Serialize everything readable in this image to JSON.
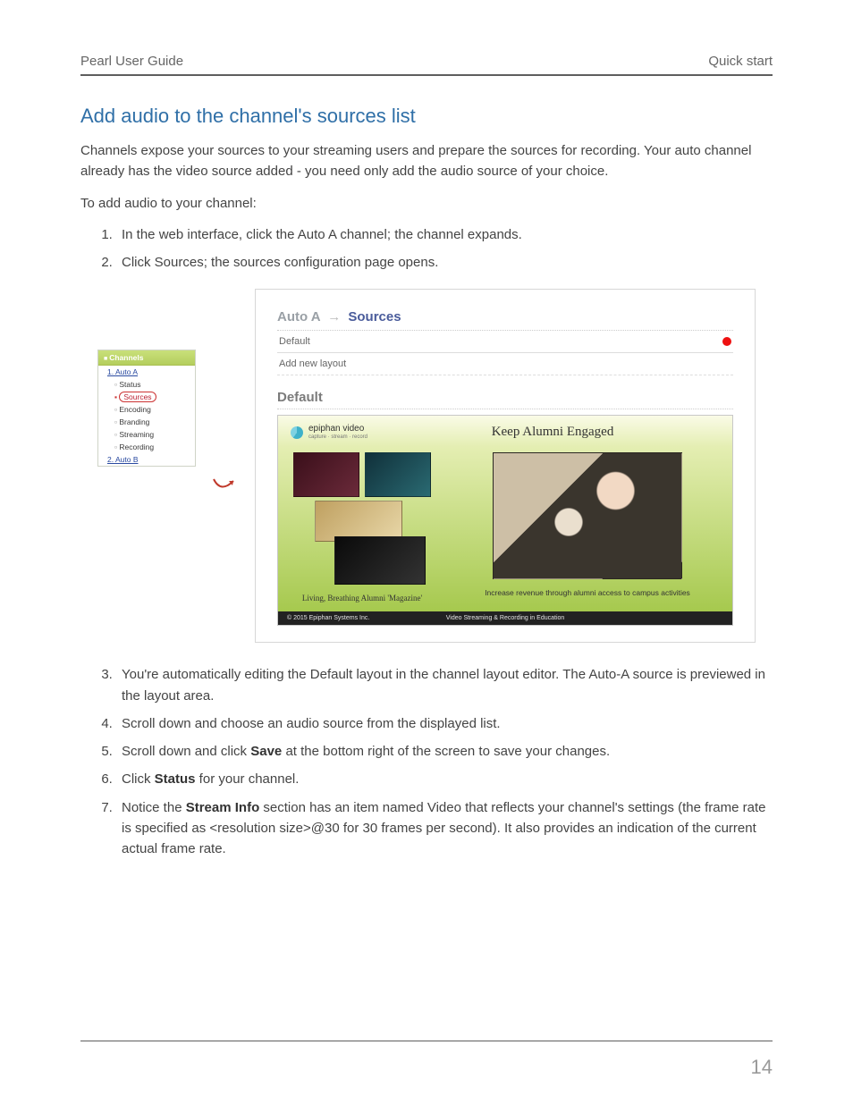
{
  "header": {
    "left": "Pearl User Guide",
    "right": "Quick start"
  },
  "title": "Add audio to the channel's sources list",
  "intro": "Channels expose your sources to your streaming users and prepare the sources for recording. Your auto channel already has the video source added - you need only add the audio source of your choice.",
  "lead": "To add audio to your channel:",
  "steps_a": [
    "In the web interface, click the Auto A channel; the channel expands.",
    "Click Sources; the sources configuration page opens."
  ],
  "steps_b": {
    "s3": "You're automatically editing the Default layout in the channel layout editor. The Auto-A source is previewed in the layout area.",
    "s4": "Scroll down and choose an audio source from the displayed list.",
    "s5a": "Scroll down and click ",
    "s5b": "Save",
    "s5c": " at the bottom right of the screen to save your changes.",
    "s6a": "Click ",
    "s6b": "Status",
    "s6c": "  for your channel.",
    "s7a": "Notice the ",
    "s7b": "Stream Info",
    "s7c": " section has an item named Video that reflects your channel's settings (the frame rate is specified as <resolution size>@30 for 30 frames per second). It also provides an indication of the current actual frame rate."
  },
  "sidebar": {
    "header": "Channels",
    "item1_prefix": "1. ",
    "item1": "Auto A",
    "subs": [
      "Status",
      "Sources",
      "Encoding",
      "Branding",
      "Streaming",
      "Recording"
    ],
    "item2_prefix": "2. ",
    "item2": "Auto B"
  },
  "panel": {
    "crumb_a": "Auto A",
    "crumb_b": "Sources",
    "row_default": "Default",
    "row_add": "Add new layout",
    "section": "Default",
    "brand": "epiphan video",
    "brand_tag": "capture · stream · record",
    "slide_title": "Keep Alumni Engaged",
    "collage_cap": "Living, Breathing Alumni 'Magazine'",
    "hero_cap": "Increase revenue through alumni access to campus activities",
    "foot_left": "© 2015 Epiphan Systems Inc.",
    "foot_mid": "Video Streaming & Recording in Education"
  },
  "page_number": "14"
}
